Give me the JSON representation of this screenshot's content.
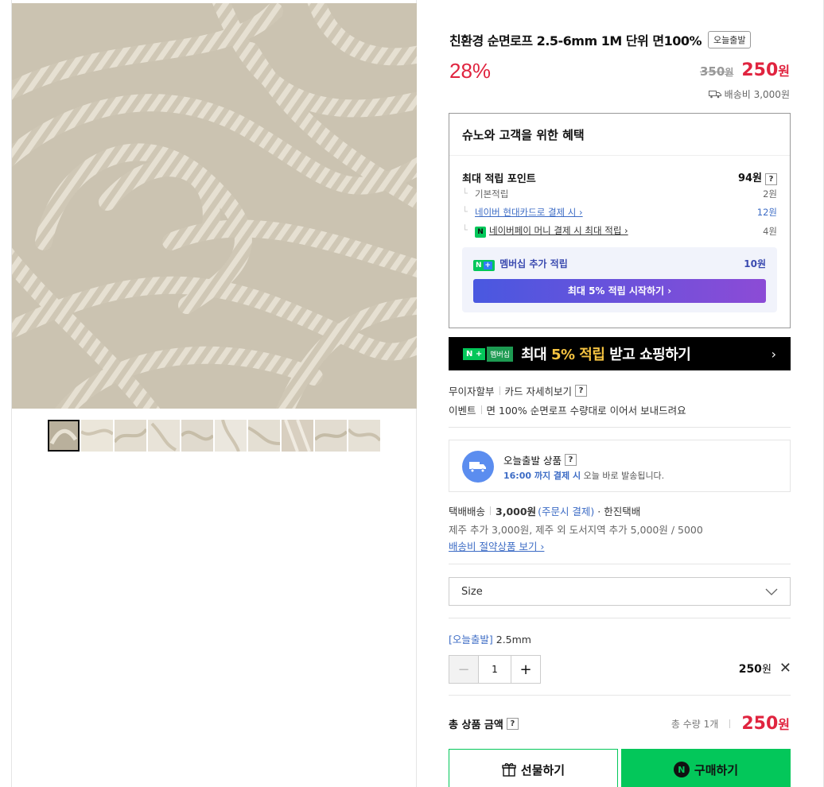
{
  "product": {
    "title": "친환경 순면로프 2.5-6mm 1M 단위 면100%",
    "badge": "오늘출발",
    "discount": "28%",
    "original_price": "350",
    "original_unit": "원",
    "sale_price": "250",
    "sale_unit": "원",
    "shipping_fee": "배송비 3,000원"
  },
  "benefits": {
    "title": "슈노와 고객을 위한 혜택",
    "max_points_label": "최대 적립 포인트",
    "max_points_value": "94원",
    "help": "?",
    "rows": [
      {
        "label": "기본적립",
        "value": "2원"
      },
      {
        "label": "네이버 현대카드로 결제 시 ›",
        "value": "12원"
      },
      {
        "label": "네이버페이 머니 결제 시 최대 적립 ›",
        "value": "4원"
      }
    ],
    "npay_mark": "N",
    "membership_mark": "N",
    "membership_plus": "+",
    "membership_label": "멤버십 추가 적립",
    "membership_value": "10원",
    "membership_button": "최대 5% 적립 시작하기 ›"
  },
  "banner": {
    "nplus": "N +",
    "membership": "멤버십",
    "text_before": "최대 ",
    "highlight": "5% 적립",
    "text_after": " 받고 쇼핑하기",
    "arrow": "›"
  },
  "info": {
    "installment": "무이자할부",
    "card_detail": "카드 자세히보기",
    "event_label": "이벤트",
    "event_text": "면 100% 순면로프 수량대로 이어서 보내드려요"
  },
  "today_ship": {
    "title": "오늘출발 상품",
    "sub_bold": "16:00 까지 결제 시",
    "sub_rest": " 오늘 바로 발송됩니다."
  },
  "delivery": {
    "method": "택배배송",
    "fee": "3,000원",
    "fee_note": "(주문시 결제)",
    "courier": "· 한진택배",
    "extra": "제주 추가 3,000원, 제주 외 도서지역 추가 5,000원 / 5000",
    "link": "배송비 절약상품 보기 ›"
  },
  "option": {
    "select_label": "Size",
    "selected_tag": "[오늘출발]",
    "selected_value": " 2.5mm",
    "quantity": "1",
    "minus": "−",
    "plus": "+",
    "price": "250",
    "price_unit": "원",
    "remove": "✕"
  },
  "total": {
    "label": "총 상품 금액",
    "qty": "총 수량 1개",
    "price": "250",
    "unit": "원"
  },
  "actions": {
    "gift": "선물하기",
    "buy": "구매하기",
    "buy_logo": "N"
  },
  "colors": {
    "accent_red": "#e0243f",
    "naver_green": "#03c75a",
    "link_blue": "#3d6cc5"
  }
}
